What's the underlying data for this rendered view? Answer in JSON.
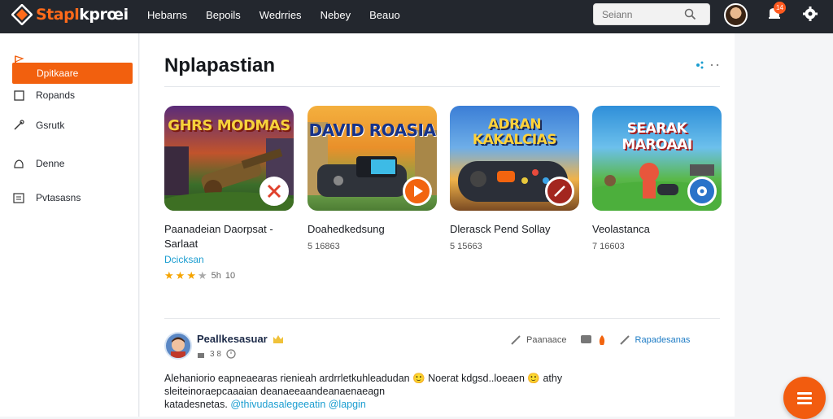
{
  "app": {
    "logo_prefix": "Stapl",
    "logo_suffix": "kprœi"
  },
  "nav": [
    "Hebarns",
    "Bepoils",
    "Wedrries",
    "Nebey",
    "Beauo"
  ],
  "search": {
    "placeholder": "Seiann"
  },
  "notifications": {
    "count": "14"
  },
  "sidebar": {
    "items": [
      {
        "label": "Dpitkaare",
        "icon": "flag-icon",
        "active": true
      },
      {
        "label": "Ropands",
        "icon": "square-icon",
        "active": false
      },
      {
        "label": "Gsrutk",
        "icon": "pen-icon",
        "active": false
      },
      {
        "label": "Denne",
        "icon": "hand-icon",
        "active": false
      },
      {
        "label": "Pvtasasns",
        "icon": "grid-icon",
        "active": false
      }
    ]
  },
  "main": {
    "title": "Nplapastian",
    "cards": [
      {
        "banner": "GHRS MODMAS",
        "title_line1": "Paanadeian Daorpsat -",
        "title_line2": "Sarlaat",
        "meta": "",
        "link": "Dcicksan",
        "rating_stars": 3.5,
        "rating_text": "5h",
        "count_text": "10",
        "accent": "#e0412c"
      },
      {
        "banner": "DAVID ROASIA",
        "title_line1": "Doahedkedsung",
        "title_line2": "",
        "meta": "5 16863",
        "link": "",
        "accent": "#f2640f"
      },
      {
        "banner": "ADRAN KAKALCIAS",
        "title_line1": "Dlerasck Pend Sollay",
        "title_line2": "",
        "meta": "5 15663",
        "link": "",
        "accent": "#a3261f"
      },
      {
        "banner": "SEARAK MAROAAI",
        "title_line1": "Veolastanca",
        "title_line2": "",
        "meta": "7 16603",
        "link": "",
        "accent": "#2a73c9"
      }
    ]
  },
  "post": {
    "user": "Peallkesasuar",
    "meta_a": "3 8",
    "action1": "Paanaace",
    "action3": "Rapadesanas",
    "body_line1": "Alehaniorio eapneaearas rienieah ardrrletkuhleadudan 🙂 Noerat kdgsd..loeaen 🙂 athy",
    "body_line2": "sleiteinoraepcaaaian deanaeeaandeanaenaeagn",
    "body_line3": "katadesnetas.",
    "body_tag": "@thivudasalegeeatin @lapgin"
  },
  "colors": {
    "accent": "#f2600e",
    "topbar": "#23272e",
    "link": "#1a9dd0"
  }
}
